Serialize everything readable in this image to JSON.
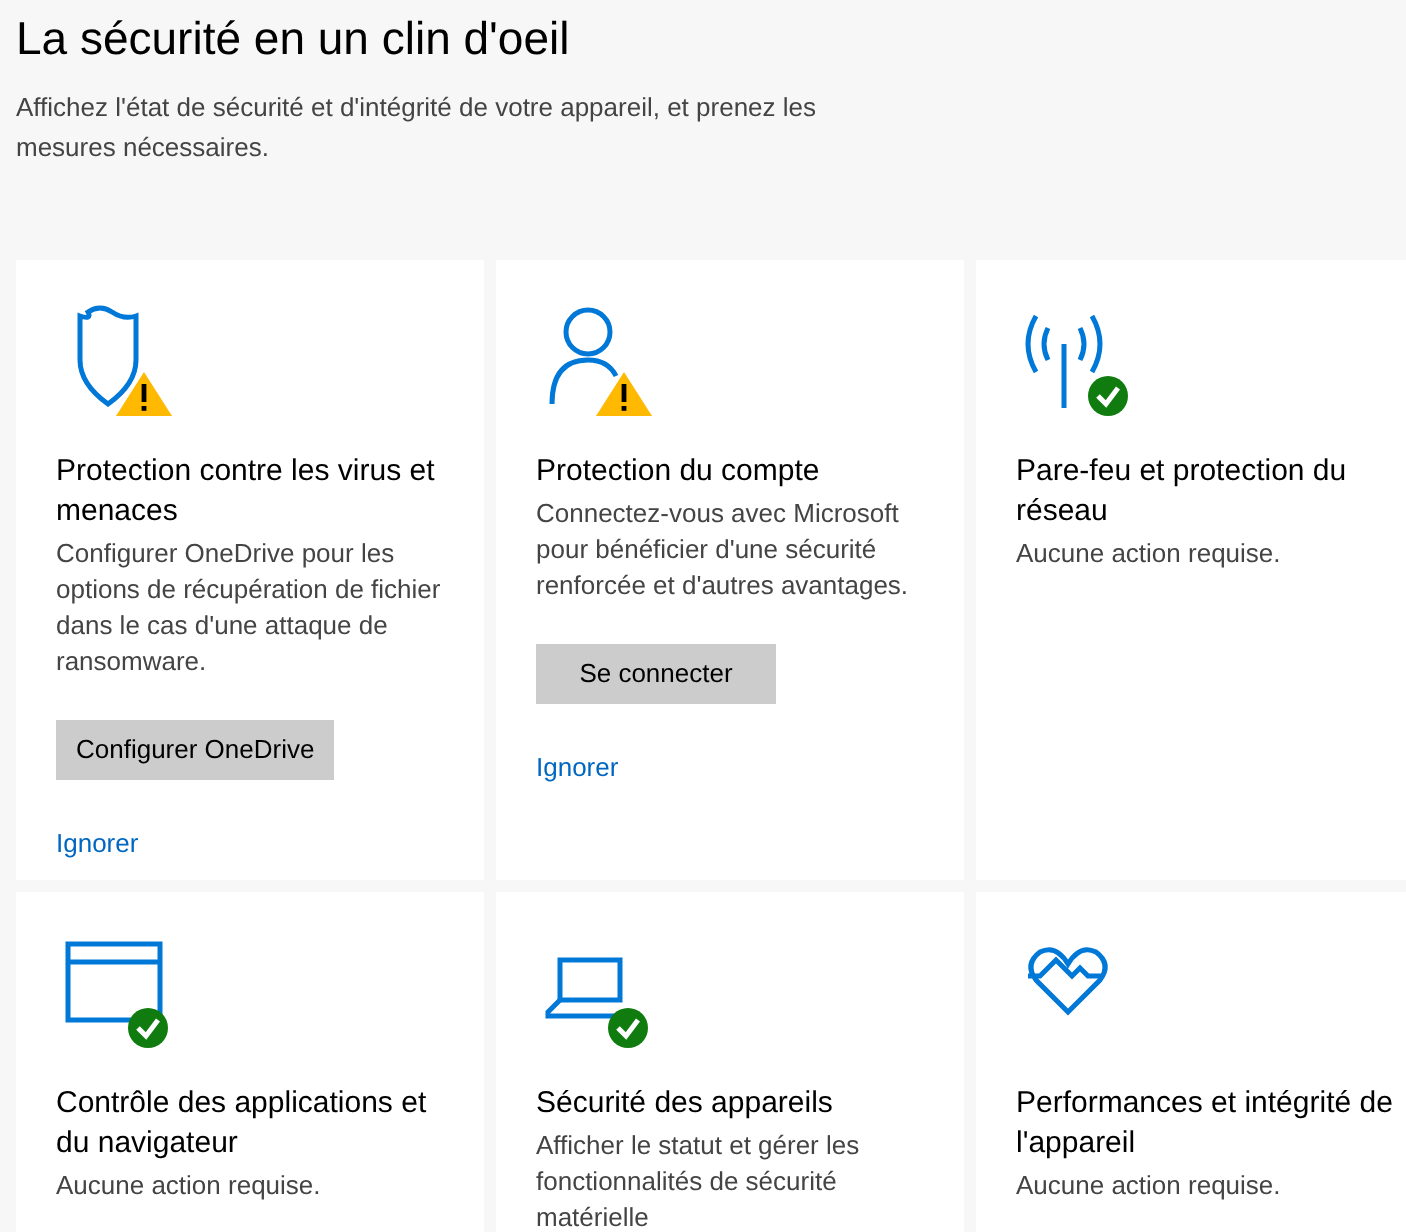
{
  "title": "La sécurité en un clin d'oeil",
  "subtitle": "Affichez l'état de sécurité et d'intégrité de votre appareil, et prenez les mesures nécessaires.",
  "cards": [
    {
      "kind": "shield",
      "warning": true,
      "checked": false,
      "title": "Protection contre les virus et menaces",
      "description": "Configurer OneDrive pour les options de récupération de fichier dans le cas d'une attaque de ransomware.",
      "button": "Configurer OneDrive",
      "link": "Ignorer"
    },
    {
      "kind": "person",
      "warning": true,
      "checked": false,
      "title": "Protection du compte",
      "description": "Connectez-vous avec Microsoft pour bénéficier d'une sécurité renforcée et d'autres avantages.",
      "button": "Se connecter",
      "link": "Ignorer"
    },
    {
      "kind": "antenna",
      "warning": false,
      "checked": true,
      "title": "Pare-feu et protection du réseau",
      "description": "Aucune action requise."
    },
    {
      "kind": "window",
      "warning": false,
      "checked": true,
      "title": "Contrôle des applications et du navigateur",
      "description": "Aucune action requise."
    },
    {
      "kind": "laptop",
      "warning": false,
      "checked": true,
      "title": "Sécurité des appareils",
      "description": "Afficher le statut et gérer les fonctionnalités de sécurité matérielle"
    },
    {
      "kind": "heart",
      "warning": false,
      "checked": false,
      "title": "Performances et intégrité de l'appareil",
      "description": "Aucune action requise."
    }
  ]
}
